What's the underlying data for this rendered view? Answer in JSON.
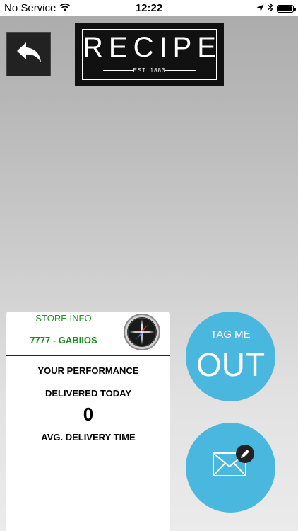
{
  "status_bar": {
    "carrier": "No Service",
    "time": "12:22"
  },
  "header": {
    "logo_text": "RECIPE",
    "logo_subtext": "EST. 1883"
  },
  "store_card": {
    "title": "STORE INFO",
    "store_code": "7777 - GABIIOS",
    "performance_title": "YOUR PERFORMANCE",
    "delivered_label": "DELIVERED TODAY",
    "delivered_value": "0",
    "avg_label": "AVG. DELIVERY TIME"
  },
  "actions": {
    "tag_small": "TAG ME",
    "tag_big": "OUT"
  },
  "colors": {
    "accent": "#4ab7df",
    "store_text": "#1a9a1a"
  },
  "icons": [
    "wifi-icon",
    "location-arrow-icon",
    "bluetooth-icon",
    "battery-icon",
    "back-arrow-icon",
    "compass-icon",
    "envelope-icon",
    "pencil-icon"
  ]
}
